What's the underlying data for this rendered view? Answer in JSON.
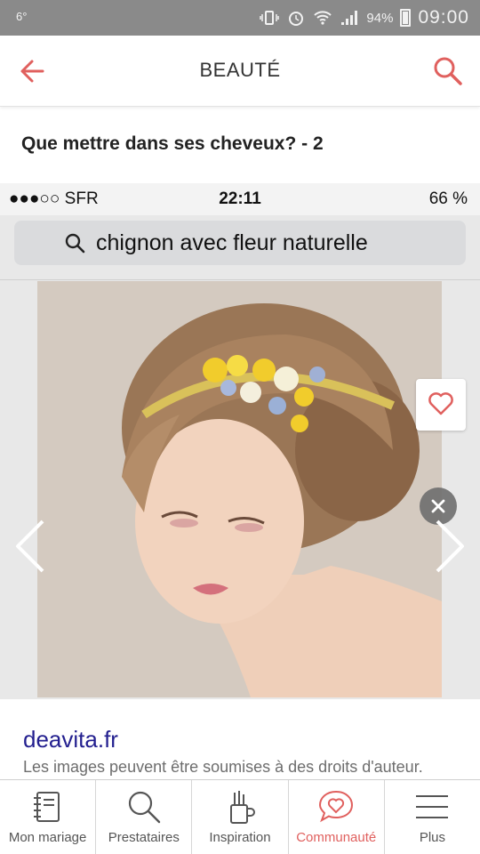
{
  "status_bar": {
    "left_text": "6°",
    "battery_percent": "94%",
    "time": "09:00"
  },
  "header": {
    "title": "BEAUTÉ",
    "back_icon": "arrow-left-icon",
    "search_icon": "search-icon",
    "accent_color": "#e0605e"
  },
  "post": {
    "title": "Que mettre dans ses cheveux? - 2"
  },
  "image": {
    "embedded_status": {
      "carrier": "●●●○○ SFR",
      "time": "22:11",
      "battery": "66 %"
    },
    "search_query": "chignon avec fleur naturelle",
    "favorite_icon": "heart-icon",
    "close_icon": "close-icon",
    "prev_icon": "chevron-left-icon",
    "next_icon": "chevron-right-icon"
  },
  "source": {
    "name": "deavita.fr",
    "note": "Les images peuvent être soumises à des droits d'auteur."
  },
  "bottom_nav": {
    "items": [
      {
        "label": "Mon mariage",
        "icon": "notebook-icon"
      },
      {
        "label": "Prestataires",
        "icon": "search-icon"
      },
      {
        "label": "Inspiration",
        "icon": "brush-cup-icon"
      },
      {
        "label": "Communauté",
        "icon": "chat-heart-icon",
        "active": true
      },
      {
        "label": "Plus",
        "icon": "menu-icon"
      }
    ]
  }
}
